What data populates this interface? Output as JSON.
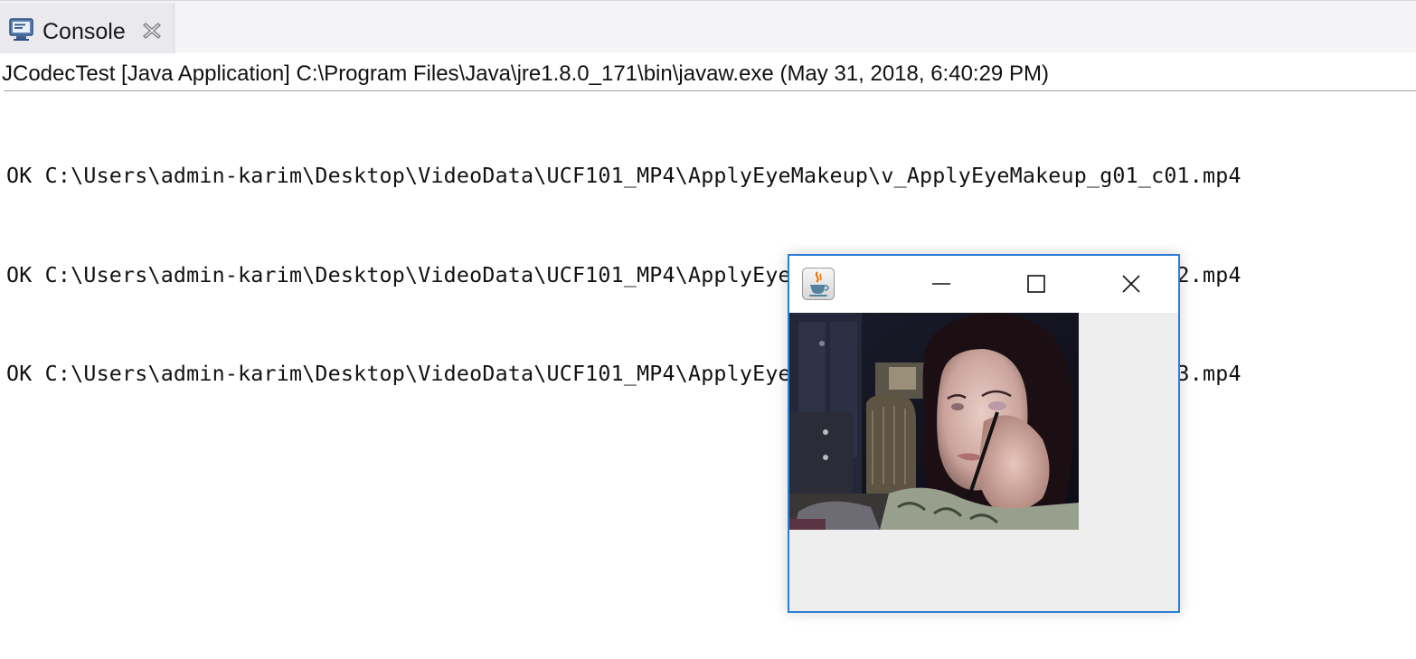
{
  "console_tab": {
    "label": "Console",
    "icon": "console-icon",
    "close_icon": "close-icon"
  },
  "launch_description": "JCodecTest [Java Application] C:\\Program Files\\Java\\jre1.8.0_171\\bin\\javaw.exe (May 31, 2018, 6:40:29 PM)",
  "output_lines": [
    "OK C:\\Users\\admin-karim\\Desktop\\VideoData\\UCF101_MP4\\ApplyEyeMakeup\\v_ApplyEyeMakeup_g01_c01.mp4",
    "OK C:\\Users\\admin-karim\\Desktop\\VideoData\\UCF101_MP4\\ApplyEyeMakeup\\v_ApplyEyeMakeup_g01_c02.mp4",
    "OK C:\\Users\\admin-karim\\Desktop\\VideoData\\UCF101_MP4\\ApplyEyeMakeup\\v_ApplyEyeMakeup_g01_c03.mp4"
  ],
  "jframe": {
    "app_icon": "java-coffee-icon",
    "buttons": [
      "minimize-icon",
      "maximize-icon",
      "close-icon"
    ],
    "accent_color": "#2b7fd4"
  }
}
